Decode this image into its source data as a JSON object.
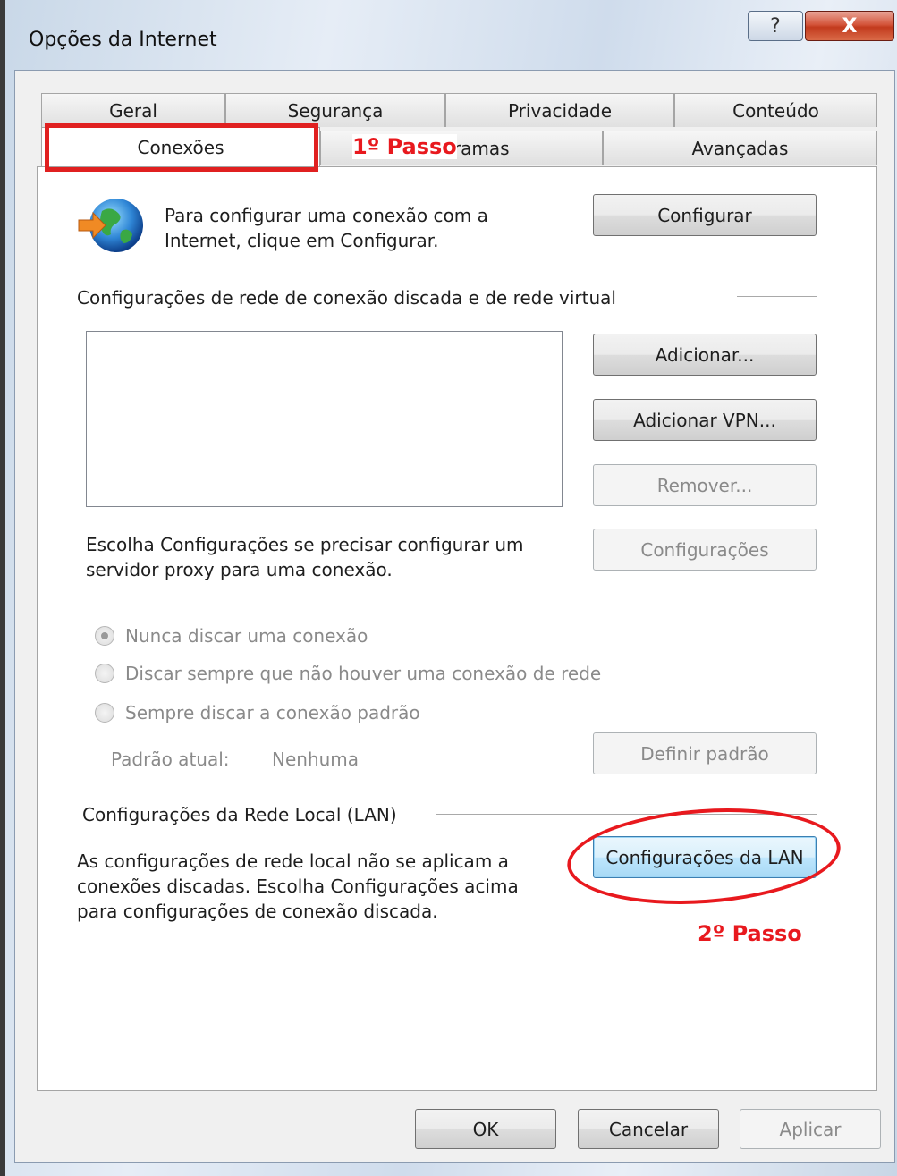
{
  "window": {
    "title": "Opções da Internet",
    "help_label": "?",
    "close_label": "X"
  },
  "tabs_row1": [
    "Geral",
    "Segurança",
    "Privacidade",
    "Conteúdo"
  ],
  "tabs_row2": [
    "Conexões",
    "Programas",
    "Avançadas"
  ],
  "active_tab": "Conexões",
  "annotations": {
    "step1": "1º Passo",
    "step2": "2º Passo"
  },
  "setup": {
    "text_line1": "Para configurar uma conexão com a",
    "text_line2": "Internet, clique em Configurar.",
    "button": "Configurar"
  },
  "dialup": {
    "heading": "Configurações de rede de conexão discada e de rede virtual",
    "add_button": "Adicionar...",
    "add_vpn_button": "Adicionar VPN...",
    "remove_button": "Remover...",
    "proxy_text_line1": "Escolha Configurações se precisar configurar um",
    "proxy_text_line2": "servidor proxy para uma conexão.",
    "settings_button": "Configurações"
  },
  "radios": [
    {
      "label": "Nunca discar uma conexão",
      "checked": true
    },
    {
      "label": "Discar sempre que não houver uma conexão de rede",
      "checked": false
    },
    {
      "label": "Sempre discar a conexão padrão",
      "checked": false
    }
  ],
  "default_conn": {
    "label": "Padrão atual:",
    "value": "Nenhuma",
    "button": "Definir padrão"
  },
  "lan": {
    "heading": "Configurações da Rede Local (LAN)",
    "text_line1": "As configurações de rede local não se aplicam a",
    "text_line2": "conexões discadas. Escolha Configurações acima",
    "text_line3": "para configurações de conexão discada.",
    "button": "Configurações da LAN"
  },
  "footer": {
    "ok": "OK",
    "cancel": "Cancelar",
    "apply": "Aplicar"
  },
  "colors": {
    "annotation": "#e8191e",
    "focus_border": "#3c7fb1"
  }
}
